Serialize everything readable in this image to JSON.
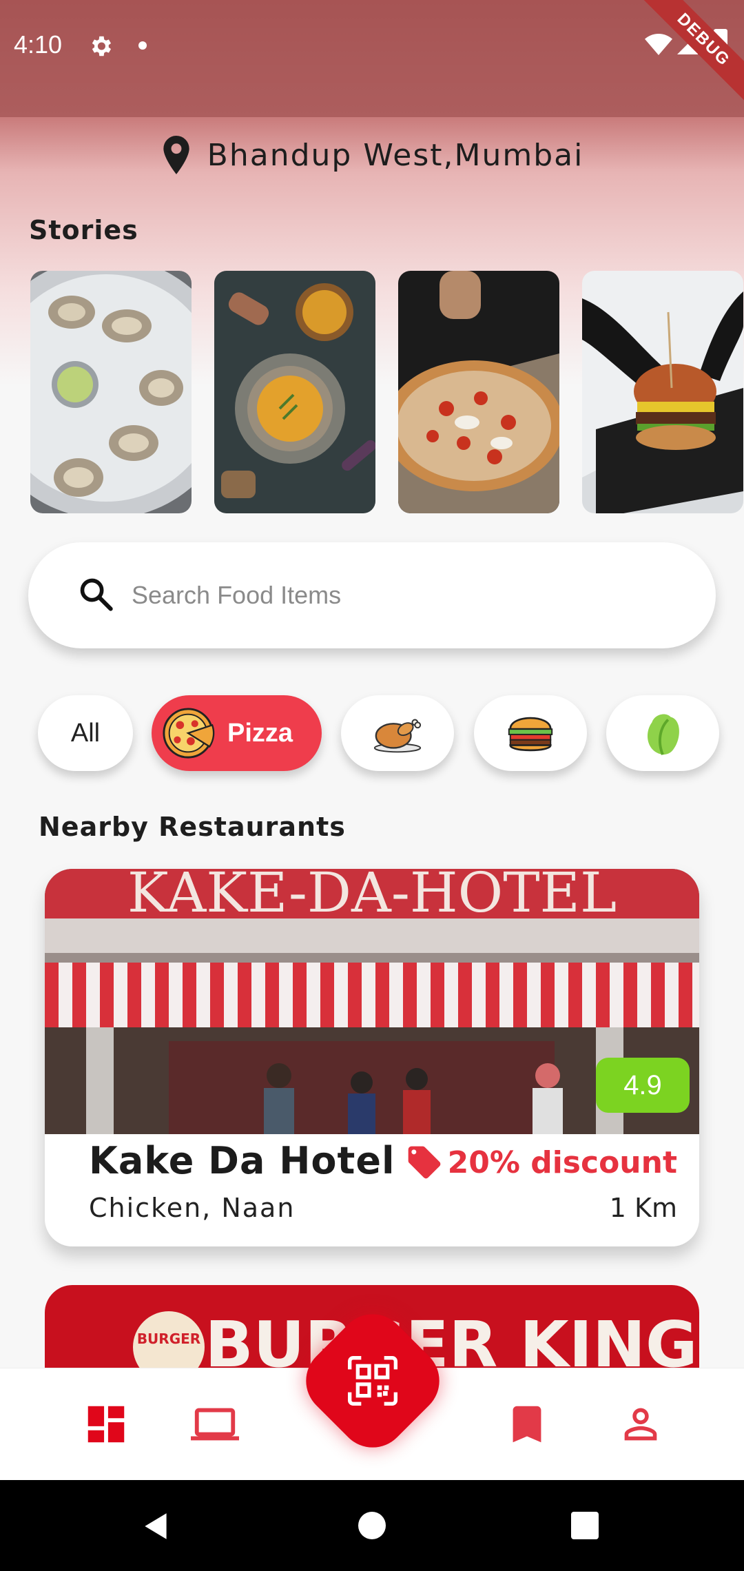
{
  "status_bar": {
    "time": "4:10",
    "debug_label": "DEBUG"
  },
  "header": {
    "location": "Bhandup West,Mumbai"
  },
  "stories": {
    "title": "Stories",
    "items": [
      {
        "subject": "oysters-on-ice"
      },
      {
        "subject": "soup-bowl"
      },
      {
        "subject": "pizza"
      },
      {
        "subject": "burger"
      }
    ]
  },
  "search": {
    "placeholder": "Search Food Items"
  },
  "categories": [
    {
      "label": "All",
      "icon": "none",
      "active": false
    },
    {
      "label": "Pizza",
      "icon": "pizza-icon",
      "active": true
    },
    {
      "label": "",
      "icon": "roast-chicken-icon",
      "active": false
    },
    {
      "label": "",
      "icon": "burger-icon",
      "active": false
    },
    {
      "label": "",
      "icon": "lettuce-icon",
      "active": false
    }
  ],
  "nearby": {
    "title": "Nearby Restaurants",
    "restaurants": [
      {
        "name": "Kake Da Hotel",
        "cuisine": "Chicken, Naan",
        "rating": "4.9",
        "discount": "20% discount",
        "distance": "1 Km",
        "sign_text": "KAKE-DA-HOTEL"
      },
      {
        "sign_text": "BURGER KING"
      }
    ]
  },
  "bottom_nav": {
    "items": [
      "dashboard-icon",
      "laptop-icon",
      "qr-scan-icon",
      "bookmark-icon",
      "person-icon"
    ]
  },
  "colors": {
    "accent": "#e0061a",
    "chip_active": "#ef3d4c",
    "rating_bg": "#7cd321",
    "discount": "#e6323f"
  }
}
